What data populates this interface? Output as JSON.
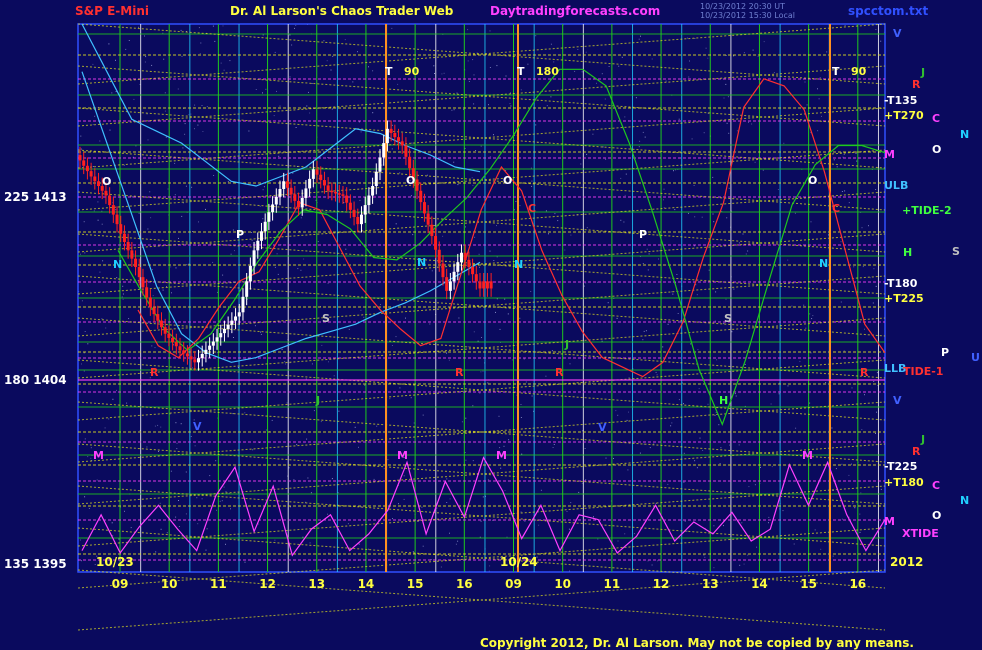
{
  "header": {
    "left_title": "S&P E-Mini",
    "center_title": "Dr. Al Larson's Chaos Trader Web",
    "site": "Daytradingforecasts.com",
    "timestamp_1": "10/23/2012 20:30 UT",
    "timestamp_2": "10/23/2012 15:30 Local",
    "file_name": "spcctom.txt"
  },
  "footer": {
    "copyright": "Copyright 2012, Dr. Al Larson. May not be copied by any means."
  },
  "colors": {
    "background": "#0a0a5e",
    "grid_green": "#1ec81e",
    "grid_yellow": "#e6e61e",
    "price_up": "#ffffff",
    "price_down": "#ff2020",
    "red_line": "#ff3030",
    "cyan_line": "#40c0ff",
    "magenta": "#ff40ff",
    "axis_blue": "#3050ff"
  },
  "chart_data": {
    "type": "line",
    "title": "S&P E-Mini",
    "y_axis_left": [
      {
        "degree": "225",
        "price": "1413"
      },
      {
        "degree": "180",
        "price": "1404"
      },
      {
        "degree": "135",
        "price": "1395"
      }
    ],
    "ylim": [
      1395,
      1418
    ],
    "date_labels": [
      "10/23",
      "10/24"
    ],
    "year_label": "2012",
    "x_ticks": [
      "09",
      "10",
      "11",
      "12",
      "13",
      "14",
      "15",
      "16",
      "09",
      "10",
      "11",
      "12",
      "13",
      "14",
      "15",
      "16"
    ],
    "right_labels": [
      {
        "text": "V",
        "color": "#4060ff"
      },
      {
        "text": "J",
        "color": "#30c030"
      },
      {
        "text": "R",
        "color": "#ff3030"
      },
      {
        "text": "-T135",
        "color": "#ffffff"
      },
      {
        "text": "+T270",
        "color": "#ffff40"
      },
      {
        "text": "C",
        "color": "#ff40ff"
      },
      {
        "text": "N",
        "color": "#20d0ff"
      },
      {
        "text": "O",
        "color": "#ffffff"
      },
      {
        "text": "M",
        "color": "#ff40ff"
      },
      {
        "text": "ULB",
        "color": "#40c0ff"
      },
      {
        "text": "+TIDE-2",
        "color": "#40ff40"
      },
      {
        "text": "H",
        "color": "#40ff40"
      },
      {
        "text": "S",
        "color": "#c0c0c0"
      },
      {
        "text": "-T180",
        "color": "#ffffff"
      },
      {
        "text": "+T225",
        "color": "#ffff40"
      },
      {
        "text": "P",
        "color": "#ffffff"
      },
      {
        "text": "U",
        "color": "#4060ff"
      },
      {
        "text": "LLB",
        "color": "#40c0ff"
      },
      {
        "text": "TIDE-1",
        "color": "#ff3030"
      },
      {
        "text": "V",
        "color": "#4060ff"
      },
      {
        "text": "J",
        "color": "#30c030"
      },
      {
        "text": "R",
        "color": "#ff3030"
      },
      {
        "text": "-T225",
        "color": "#ffffff"
      },
      {
        "text": "+T180",
        "color": "#ffff40"
      },
      {
        "text": "C",
        "color": "#ff40ff"
      },
      {
        "text": "N",
        "color": "#20d0ff"
      },
      {
        "text": "O",
        "color": "#ffffff"
      },
      {
        "text": "M",
        "color": "#ff40ff"
      },
      {
        "text": "XTIDE",
        "color": "#ff40ff"
      }
    ],
    "top_markers": [
      {
        "text": "T",
        "color": "#ffffff"
      },
      {
        "text": "90",
        "color": "#ffff40"
      },
      {
        "text": "T",
        "color": "#ffffff"
      },
      {
        "text": "180",
        "color": "#ffff40"
      },
      {
        "text": "T",
        "color": "#ffffff"
      },
      {
        "text": "90",
        "color": "#ffff40"
      }
    ],
    "in_chart_letters": [
      {
        "text": "O",
        "color": "#ffffff"
      },
      {
        "text": "N",
        "color": "#20d0ff"
      },
      {
        "text": "P",
        "color": "#ffffff"
      },
      {
        "text": "S",
        "color": "#c0c0c0"
      },
      {
        "text": "R",
        "color": "#ff3030"
      },
      {
        "text": "V",
        "color": "#4060ff"
      },
      {
        "text": "J",
        "color": "#30c030"
      },
      {
        "text": "M",
        "color": "#ff40ff"
      },
      {
        "text": "O",
        "color": "#ffffff"
      },
      {
        "text": "N",
        "color": "#20d0ff"
      },
      {
        "text": "M",
        "color": "#ff40ff"
      },
      {
        "text": "R",
        "color": "#ff3030"
      },
      {
        "text": "O",
        "color": "#ffffff"
      },
      {
        "text": "N",
        "color": "#20d0ff"
      },
      {
        "text": "C",
        "color": "#ff3030"
      },
      {
        "text": "J",
        "color": "#30c030"
      },
      {
        "text": "R",
        "color": "#ff3030"
      },
      {
        "text": "M",
        "color": "#ff40ff"
      },
      {
        "text": "P",
        "color": "#ffffff"
      },
      {
        "text": "V",
        "color": "#4060ff"
      },
      {
        "text": "S",
        "color": "#c0c0c0"
      },
      {
        "text": "H",
        "color": "#40ff40"
      },
      {
        "text": "O",
        "color": "#ffffff"
      },
      {
        "text": "N",
        "color": "#20d0ff"
      },
      {
        "text": "C",
        "color": "#ff3030"
      },
      {
        "text": "R",
        "color": "#ff3030"
      },
      {
        "text": "M",
        "color": "#ff40ff"
      }
    ],
    "series": [
      {
        "name": "price_close",
        "values": [
          1412.5,
          1411.6,
          1410.8,
          1409.2,
          1407.8,
          1406.1,
          1405.0,
          1404.3,
          1403.8,
          1404.5,
          1405.2,
          1405.9,
          1408.5,
          1410.1,
          1411.4,
          1410.3,
          1411.9,
          1411.0,
          1410.8,
          1409.6,
          1411.2,
          1413.6,
          1412.9,
          1411.0,
          1409.1,
          1406.8,
          1408.4,
          1407.2
        ]
      },
      {
        "name": "cyan_band_upper",
        "values": [
          1418,
          1416,
          1414,
          1413.5,
          1413,
          1412.2,
          1411.4,
          1411.2,
          1411.6,
          1412,
          1412.8,
          1413.6,
          1413.4,
          1412.9,
          1412.5,
          1412,
          1411.8
        ]
      },
      {
        "name": "cyan_band_lower",
        "values": [
          1416,
          1413,
          1410,
          1407,
          1405,
          1404.2,
          1403.8,
          1404,
          1404.4,
          1404.8,
          1405.1,
          1405.4,
          1405.9,
          1406.3,
          1406.8,
          1407.4,
          1408
        ]
      },
      {
        "name": "red_forecast",
        "values": [
          1406,
          1404.5,
          1404,
          1404.8,
          1406.1,
          1407.2,
          1407.6,
          1409,
          1410.5,
          1410.2,
          1408.6,
          1407,
          1406,
          1405.2,
          1404.5,
          1404.8,
          1407.5,
          1410.2,
          1412,
          1411,
          1408.5,
          1406.6,
          1405.1,
          1404,
          1403.6,
          1403.2,
          1403.8,
          1405.5,
          1408.2,
          1410.5,
          1414.5,
          1415.7,
          1415.4,
          1414.4,
          1411.8,
          1408.6,
          1405.4,
          1404.2
        ]
      },
      {
        "name": "green_forecast",
        "values": [
          1408.5,
          1406.8,
          1405.2,
          1404.3,
          1405,
          1406.4,
          1408,
          1409.3,
          1410.2,
          1410,
          1409.4,
          1408.2,
          1408.1,
          1408.8,
          1409.8,
          1410.7,
          1411.9,
          1413.3,
          1414.9,
          1416.1,
          1416.1,
          1415.4,
          1413,
          1410.1,
          1407,
          1403.5,
          1401.2,
          1403.9,
          1407.2,
          1410.4,
          1412.1,
          1412.9,
          1412.9,
          1412.6
        ]
      },
      {
        "name": "xtide",
        "values": [
          1395.9,
          1397.4,
          1395.8,
          1396.9,
          1397.8,
          1396.8,
          1395.9,
          1398.2,
          1399.4,
          1396.7,
          1398.6,
          1395.7,
          1396.8,
          1397.4,
          1395.9,
          1396.6,
          1397.6,
          1399.6,
          1396.6,
          1398.8,
          1397.3,
          1399.8,
          1398.4,
          1396.4,
          1397.8,
          1395.9,
          1397.4,
          1397.2,
          1395.8,
          1396.5,
          1397.8,
          1396.3,
          1397.1,
          1396.6,
          1397.5,
          1396.3,
          1396.8,
          1399.5,
          1397.8,
          1399.6,
          1397.4,
          1395.9,
          1397.2
        ]
      }
    ]
  }
}
